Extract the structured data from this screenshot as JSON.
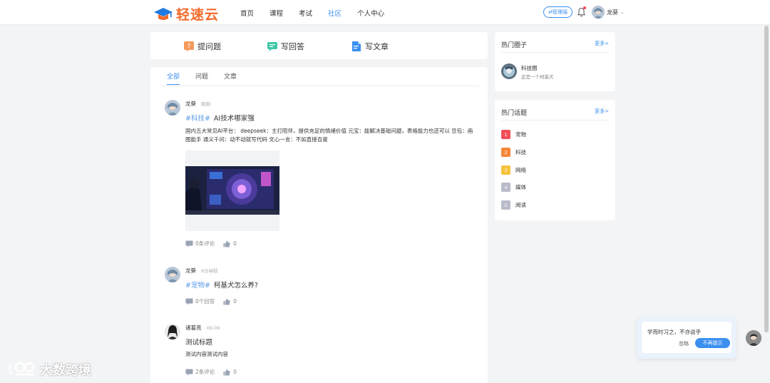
{
  "header": {
    "logo_text": "轻速云",
    "nav": [
      {
        "label": "首页"
      },
      {
        "label": "课程"
      },
      {
        "label": "考试"
      },
      {
        "label": "社区"
      },
      {
        "label": "个人中心"
      }
    ],
    "active_nav": "社区",
    "admin_label": "⇄管理端",
    "user_name": "龙葵"
  },
  "actions": {
    "ask": "提问题",
    "answer": "写回答",
    "article": "写文章"
  },
  "tabs": [
    {
      "label": "全部"
    },
    {
      "label": "问题"
    },
    {
      "label": "文章"
    }
  ],
  "posts": [
    {
      "author": "龙葵",
      "time": "刚刚",
      "tag": "#科技#",
      "title": "AI技术哪家强",
      "body": "国内五大常见AI平台： deepseek：主打陪伴，提供充足的情绪价值 元宝：能解决基础问题，表格能力也还可以 豆包：画图能手 通义千问：动不动就写代码 文心一言：不如直接百度",
      "comments": "0条评论",
      "likes": "0"
    },
    {
      "author": "龙葵",
      "time": "6分钟前",
      "tag": "#宠物#",
      "title": "柯基犬怎么养?",
      "comments": "0个回答",
      "likes": "0"
    },
    {
      "author": "诸葛亮",
      "time": "09-09",
      "title": "测试标题",
      "body": "测试内容测试内容",
      "comments": "2条评论",
      "likes": "0"
    }
  ],
  "hot_circles": {
    "title": "热门圈子",
    "more": "更多>",
    "items": [
      {
        "name": "科技圈",
        "desc": "这是一个柯基犬"
      }
    ]
  },
  "hot_topics": {
    "title": "热门话题",
    "more": "更多>",
    "items": [
      {
        "rank": "1",
        "name": "宠物",
        "color": "#f0505a"
      },
      {
        "rank": "2",
        "name": "科技",
        "color": "#f5873a"
      },
      {
        "rank": "3",
        "name": "网络",
        "color": "#f7c23c"
      },
      {
        "rank": "4",
        "name": "媒体",
        "color": "#b9bcc8"
      },
      {
        "rank": "5",
        "name": "阅读",
        "color": "#b9bcc8"
      }
    ]
  },
  "popup": {
    "text": "学而时习之，不亦说乎",
    "ignore": "忽略",
    "never": "不再提示"
  },
  "watermark": "大数跨境",
  "colors": {
    "accent": "#3b8ff0",
    "brand": "#f26b2b"
  }
}
